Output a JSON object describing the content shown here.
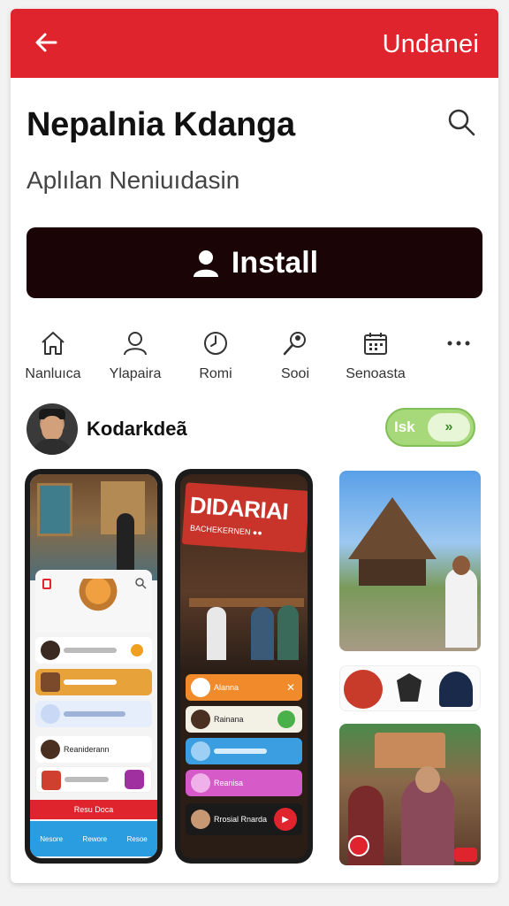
{
  "header": {
    "action_label": "Undanei",
    "accent_color": "#e0242e",
    "back_icon": "arrow-left-icon"
  },
  "app": {
    "title": "Nepalnia Kdanga",
    "subtitle": "Aplılan Neniuıdasin",
    "install_label": "Install",
    "install_icon": "person-icon",
    "search_icon": "search-icon"
  },
  "nav": [
    {
      "label": "Nanluıca",
      "icon": "home-icon"
    },
    {
      "label": "Ylapaira",
      "icon": "person-outline-icon"
    },
    {
      "label": "Romi",
      "icon": "clock-icon"
    },
    {
      "label": "Sooi",
      "icon": "search-person-icon"
    },
    {
      "label": "Senoasta",
      "icon": "calendar-grid-icon"
    },
    {
      "label": "",
      "icon": "more-dots-icon"
    }
  ],
  "publisher": {
    "name": "Kodarkdeã",
    "follow_label": "Isk",
    "follow_icon": "double-chevron-right-icon"
  },
  "screenshots": {
    "phone1": {
      "rows": [
        "",
        "",
        "",
        "Reaniderann",
        ""
      ],
      "bottom_banner": "Resu Doca",
      "tabs": [
        "Nesore",
        "Rewore",
        "Resoe"
      ]
    },
    "phone2": {
      "sign_text": "DIDARIAI",
      "sign_subtext": "BACHEKERNEN ●●",
      "rows": [
        "Alanna",
        "Rainana",
        "",
        "Reanisa",
        "Rrosial Rnarda"
      ]
    }
  }
}
